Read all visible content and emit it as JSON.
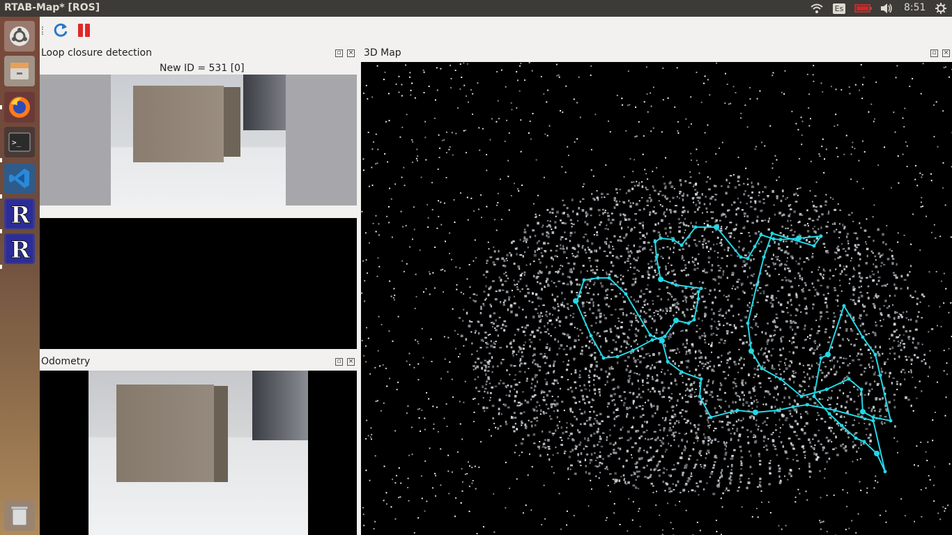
{
  "window": {
    "title": "RTAB-Map* [ROS]"
  },
  "tray": {
    "keyboard": "Es",
    "clock": "8:51",
    "icons": [
      "wifi-icon",
      "battery-icon",
      "volume-icon",
      "power-icon"
    ]
  },
  "launcher": {
    "items": [
      "ubuntu-home-icon",
      "files-icon",
      "firefox-icon",
      "terminal-icon",
      "vscode-icon",
      "rtabmap-icon",
      "rtabmap-icon",
      "trash-icon"
    ]
  },
  "toolbar": {
    "buttons": [
      "refresh-icon",
      "pause-icon"
    ]
  },
  "panels": {
    "loop": {
      "title": "Loop closure detection",
      "status": "New ID = 531 [0]"
    },
    "odometry": {
      "title": "Odometry"
    },
    "map": {
      "title": "3D Map"
    }
  },
  "colors": {
    "trajectory": "#22d8e6",
    "topbar": "#3c3b37",
    "panel_bg": "#f2f1f0"
  }
}
